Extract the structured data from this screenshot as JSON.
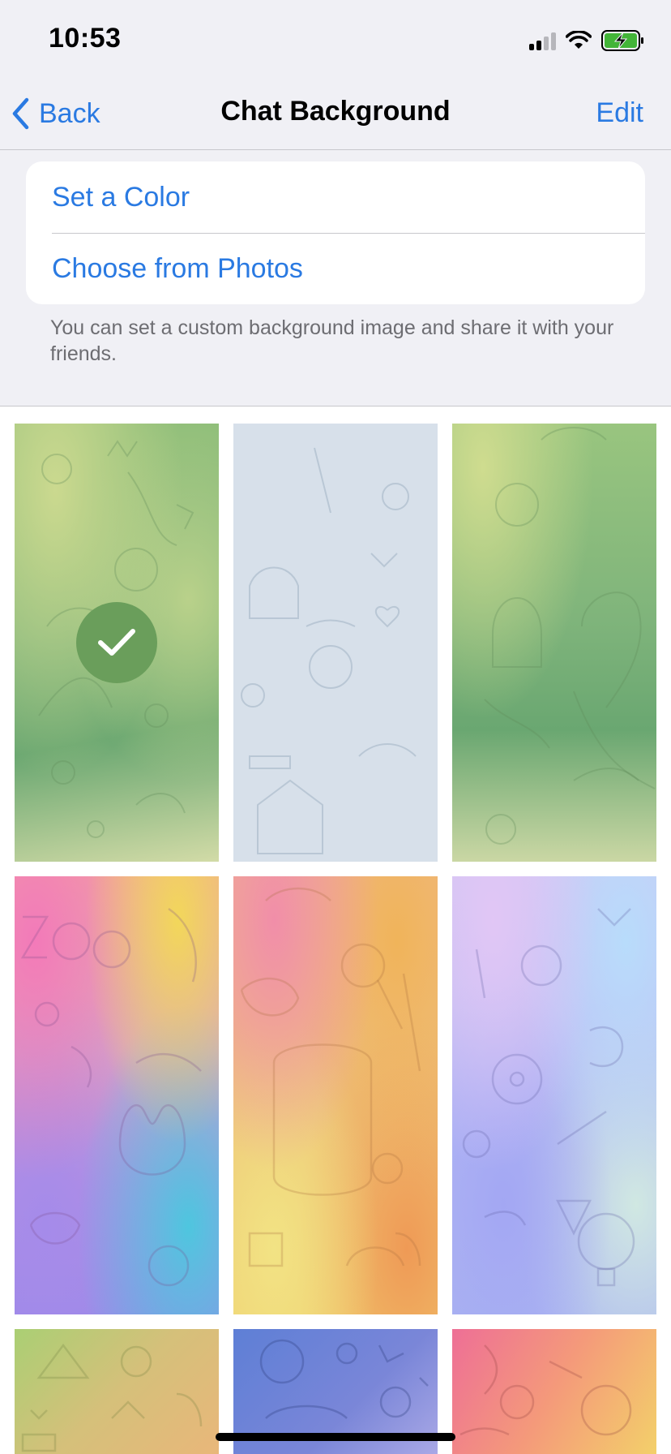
{
  "status_bar": {
    "time": "10:53",
    "icons": [
      "signal-icon",
      "wifi-icon",
      "battery-charging-icon"
    ]
  },
  "nav": {
    "back_label": "Back",
    "title": "Chat Background",
    "edit_label": "Edit"
  },
  "options": {
    "set_color": "Set a Color",
    "choose_photos": "Choose from Photos"
  },
  "footer_text": "You can set a custom background image and share it with your friends.",
  "wallpapers": [
    {
      "name": "green-doodle",
      "selected": true
    },
    {
      "name": "light-blue-doodle",
      "selected": false
    },
    {
      "name": "green-animals",
      "selected": false
    },
    {
      "name": "rainbow-zoo",
      "selected": false
    },
    {
      "name": "sweets-pastel",
      "selected": false
    },
    {
      "name": "lilac-blue",
      "selected": false
    },
    {
      "name": "green-yellow",
      "selected": false
    },
    {
      "name": "blue-space",
      "selected": false
    },
    {
      "name": "pink-yellow",
      "selected": false
    }
  ],
  "colors": {
    "accent": "#2a7ae2",
    "background": "#f0f0f5",
    "selected_check": "#6a9e5b"
  }
}
